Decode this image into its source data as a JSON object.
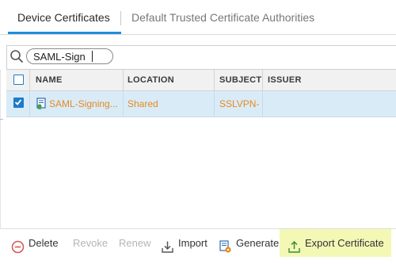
{
  "tabs": {
    "active": "Device Certificates",
    "inactive": "Default Trusted Certificate Authorities"
  },
  "search": {
    "value": "SAML-Sign",
    "icon": "search-icon"
  },
  "table": {
    "columns": [
      "NAME",
      "LOCATION",
      "SUBJECT",
      "ISSUER"
    ],
    "rows": [
      {
        "checked": true,
        "name": "SAML-Signing...",
        "location": "Shared",
        "subject": "SSLVPN-",
        "issuer": ""
      }
    ],
    "text_color": "#e8891e",
    "selected_row_color": "#d9ebf7"
  },
  "toolbar": {
    "delete": "Delete",
    "revoke": "Revoke",
    "renew": "Renew",
    "import": "Import",
    "generate": "Generate",
    "export": "Export Certificate",
    "highlight_color": "#f3f8b5"
  },
  "colors": {
    "accent": "#1f8ddc",
    "checkbox": "#1f7bc7"
  }
}
